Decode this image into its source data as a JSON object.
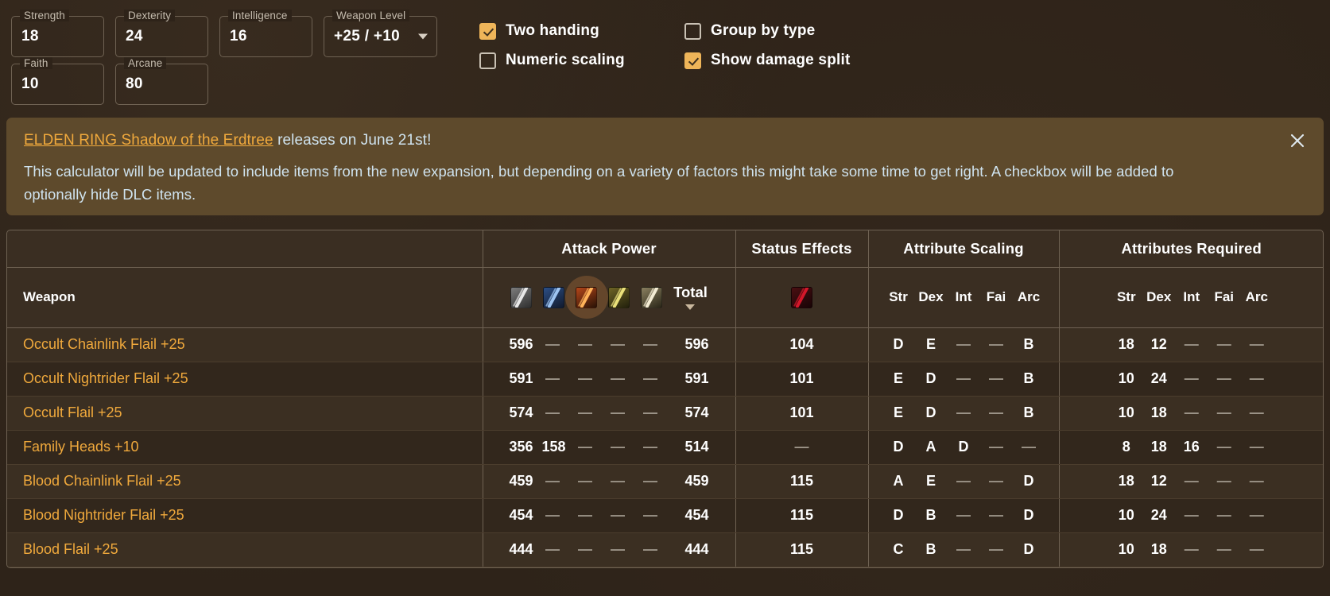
{
  "stats": {
    "fields": [
      {
        "label": "Strength",
        "value": "18",
        "type": "input"
      },
      {
        "label": "Dexterity",
        "value": "24",
        "type": "input"
      },
      {
        "label": "Intelligence",
        "value": "16",
        "type": "input"
      },
      {
        "label": "Weapon Level",
        "value": "+25 / +10",
        "type": "select"
      },
      {
        "label": "Faith",
        "value": "10",
        "type": "input"
      },
      {
        "label": "Arcane",
        "value": "80",
        "type": "input"
      }
    ]
  },
  "options": [
    {
      "label": "Two handing",
      "checked": true
    },
    {
      "label": "Group by type",
      "checked": false
    },
    {
      "label": "Numeric scaling",
      "checked": false
    },
    {
      "label": "Show damage split",
      "checked": true
    }
  ],
  "banner": {
    "link_text": "ELDEN RING Shadow of the Erdtree",
    "title_rest": " releases on June 21st!",
    "body": "This calculator will be updated to include items from the new expansion, but depending on a variety of factors this might take some time to get right. A checkbox will be added to optionally hide DLC items.",
    "close_label": "close-icon",
    "background": "#5e4a2c",
    "link_color": "#f0a93c",
    "text_color": "#cfe3ef"
  },
  "table": {
    "groups": {
      "weapon": "Weapon",
      "attack_power": "Attack Power",
      "status_effects": "Status Effects",
      "attribute_scaling": "Attribute Scaling",
      "attributes_required": "Attributes Required"
    },
    "damage_icons": [
      {
        "name": "physical-damage-icon",
        "cls": "ico-phy",
        "active": false
      },
      {
        "name": "magic-damage-icon",
        "cls": "ico-mag",
        "active": false
      },
      {
        "name": "fire-damage-icon",
        "cls": "ico-fire",
        "active": true
      },
      {
        "name": "lightning-damage-icon",
        "cls": "ico-lgt",
        "active": false
      },
      {
        "name": "holy-damage-icon",
        "cls": "ico-hly",
        "active": false
      }
    ],
    "status_icon": {
      "name": "bleed-status-icon",
      "cls": "ico-bleed"
    },
    "total_label": "Total",
    "sort_direction": "desc",
    "attribute_keys": [
      "Str",
      "Dex",
      "Int",
      "Fai",
      "Arc"
    ],
    "rows": [
      {
        "name": "Occult Chainlink Flail +25",
        "damage": [
          "596",
          "—",
          "—",
          "—",
          "—"
        ],
        "total": "596",
        "status": "104",
        "scaling": [
          "D",
          "E",
          "—",
          "—",
          "B"
        ],
        "required": [
          "18",
          "12",
          "—",
          "—",
          "—"
        ]
      },
      {
        "name": "Occult Nightrider Flail +25",
        "damage": [
          "591",
          "—",
          "—",
          "—",
          "—"
        ],
        "total": "591",
        "status": "101",
        "scaling": [
          "E",
          "D",
          "—",
          "—",
          "B"
        ],
        "required": [
          "10",
          "24",
          "—",
          "—",
          "—"
        ]
      },
      {
        "name": "Occult Flail +25",
        "damage": [
          "574",
          "—",
          "—",
          "—",
          "—"
        ],
        "total": "574",
        "status": "101",
        "scaling": [
          "E",
          "D",
          "—",
          "—",
          "B"
        ],
        "required": [
          "10",
          "18",
          "—",
          "—",
          "—"
        ]
      },
      {
        "name": "Family Heads +10",
        "damage": [
          "356",
          "158",
          "—",
          "—",
          "—"
        ],
        "total": "514",
        "status": "—",
        "scaling": [
          "D",
          "A",
          "D",
          "—",
          "—"
        ],
        "required": [
          "8",
          "18",
          "16",
          "—",
          "—"
        ]
      },
      {
        "name": "Blood Chainlink Flail +25",
        "damage": [
          "459",
          "—",
          "—",
          "—",
          "—"
        ],
        "total": "459",
        "status": "115",
        "scaling": [
          "A",
          "E",
          "—",
          "—",
          "D"
        ],
        "required": [
          "18",
          "12",
          "—",
          "—",
          "—"
        ]
      },
      {
        "name": "Blood Nightrider Flail +25",
        "damage": [
          "454",
          "—",
          "—",
          "—",
          "—"
        ],
        "total": "454",
        "status": "115",
        "scaling": [
          "D",
          "B",
          "—",
          "—",
          "D"
        ],
        "required": [
          "10",
          "24",
          "—",
          "—",
          "—"
        ]
      },
      {
        "name": "Blood Flail +25",
        "damage": [
          "444",
          "—",
          "—",
          "—",
          "—"
        ],
        "total": "444",
        "status": "115",
        "scaling": [
          "C",
          "B",
          "—",
          "—",
          "D"
        ],
        "required": [
          "10",
          "18",
          "—",
          "—",
          "—"
        ]
      }
    ]
  }
}
